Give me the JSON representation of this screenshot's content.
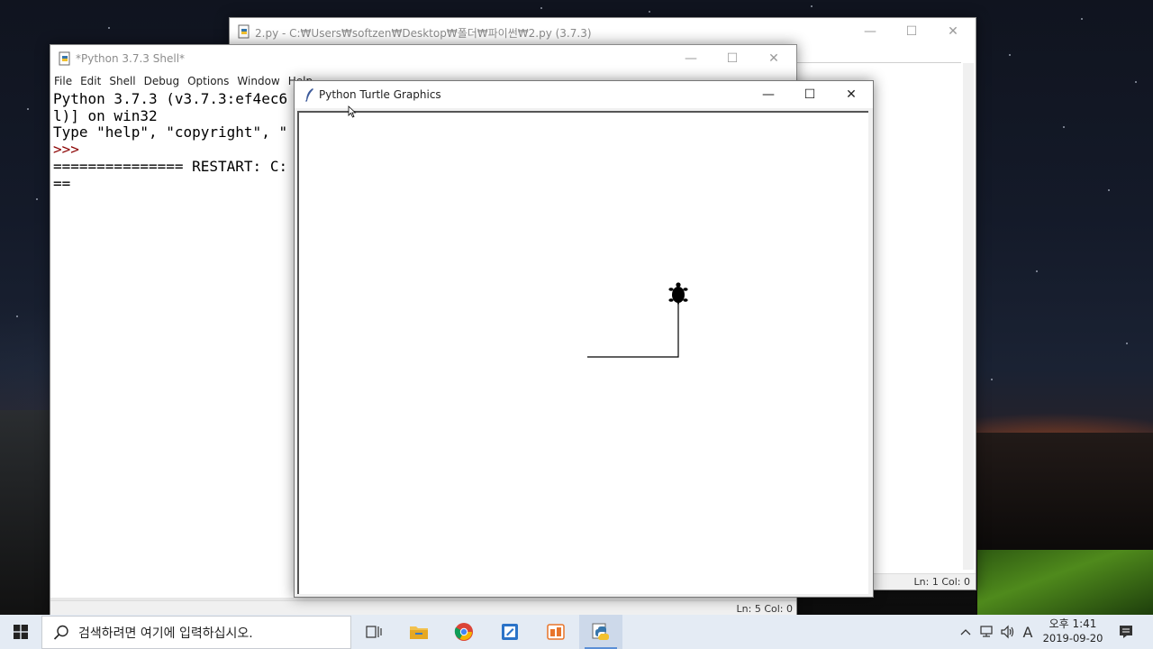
{
  "editor_window": {
    "title": "2.py - C:₩Users₩softzen₩Desktop₩폴더₩파이썬₩2.py (3.7.3)",
    "status": "Ln: 1  Col: 0"
  },
  "shell_window": {
    "title": "*Python 3.7.3 Shell*",
    "menu": [
      "File",
      "Edit",
      "Shell",
      "Debug",
      "Options",
      "Window",
      "Help"
    ],
    "lines": {
      "l1": "Python 3.7.3 (v3.7.3:ef4ec6",
      "l2": "l)] on win32",
      "l3": "Type \"help\", \"copyright\", \"",
      "l4": ">>> ",
      "l5": "=============== RESTART: C:",
      "l6": "=="
    },
    "status": "Ln: 5  Col: 0"
  },
  "turtle_window": {
    "title": "Python Turtle Graphics"
  },
  "window_controls": {
    "minimize": "—",
    "maximize": "☐",
    "close": "✕"
  },
  "taskbar": {
    "search_placeholder": "검색하려면 여기에 입력하십시오.",
    "ime_indicator": "A",
    "clock_time": "오후 1:41",
    "clock_date": "2019-09-20",
    "colors": {
      "accent": "#5a8fd6",
      "background": "#e4ebf4"
    }
  }
}
